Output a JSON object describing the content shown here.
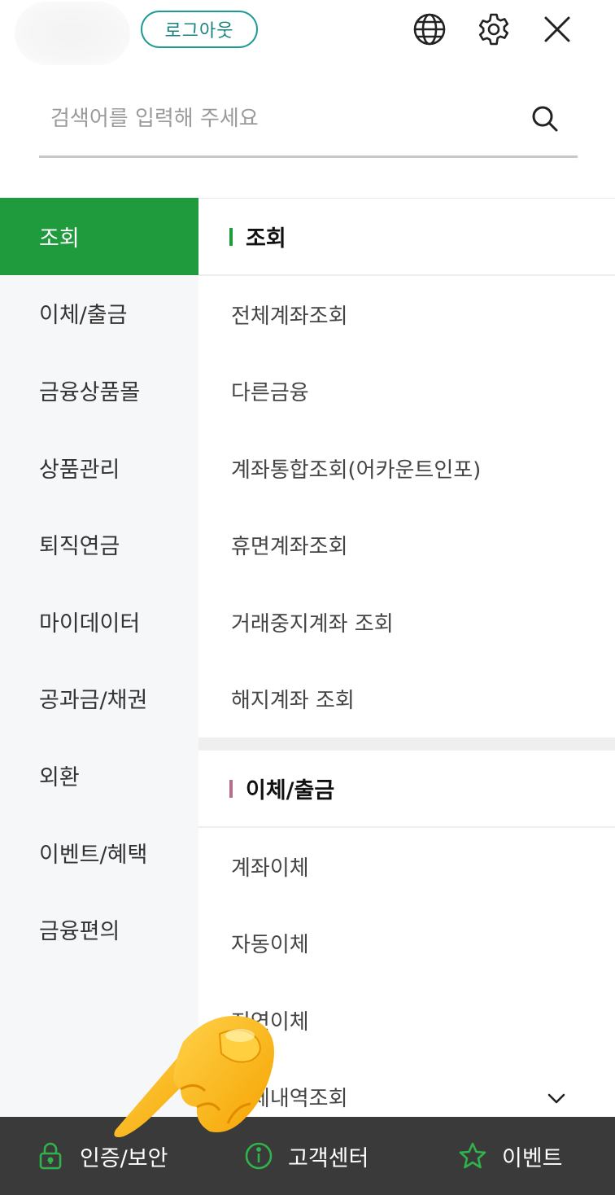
{
  "header": {
    "logout_label": "로그아웃",
    "icons": [
      "globe-icon",
      "gear-icon",
      "close-icon"
    ]
  },
  "search": {
    "placeholder": "검색어를 입력해 주세요",
    "icon": "search-icon"
  },
  "left_nav": {
    "items": [
      {
        "label": "조회",
        "active": true
      },
      {
        "label": "이체/출금"
      },
      {
        "label": "금융상품몰"
      },
      {
        "label": "상품관리"
      },
      {
        "label": "퇴직연금"
      },
      {
        "label": "마이데이터"
      },
      {
        "label": "공과금/채권"
      },
      {
        "label": "외환"
      },
      {
        "label": "이벤트/혜택"
      },
      {
        "label": "금융편의"
      }
    ]
  },
  "sections": [
    {
      "title": "조회",
      "accent": "#1f9a3d",
      "items": [
        "전체계좌조회",
        "다른금융",
        "계좌통합조회(어카운트인포)",
        "휴면계좌조회",
        "거래중지계좌 조회",
        "해지계좌 조회"
      ]
    },
    {
      "title": "이체/출금",
      "accent": "#b76e8e",
      "items": [
        "계좌이체",
        "자동이체",
        "지연이체",
        "이체내역조회"
      ]
    }
  ],
  "bottom_bar": {
    "items": [
      {
        "label": "인증/보안",
        "icon": "lock-icon"
      },
      {
        "label": "고객센터",
        "icon": "info-icon"
      },
      {
        "label": "이벤트",
        "icon": "star-icon"
      }
    ],
    "icon_color": "#2fb34a"
  }
}
